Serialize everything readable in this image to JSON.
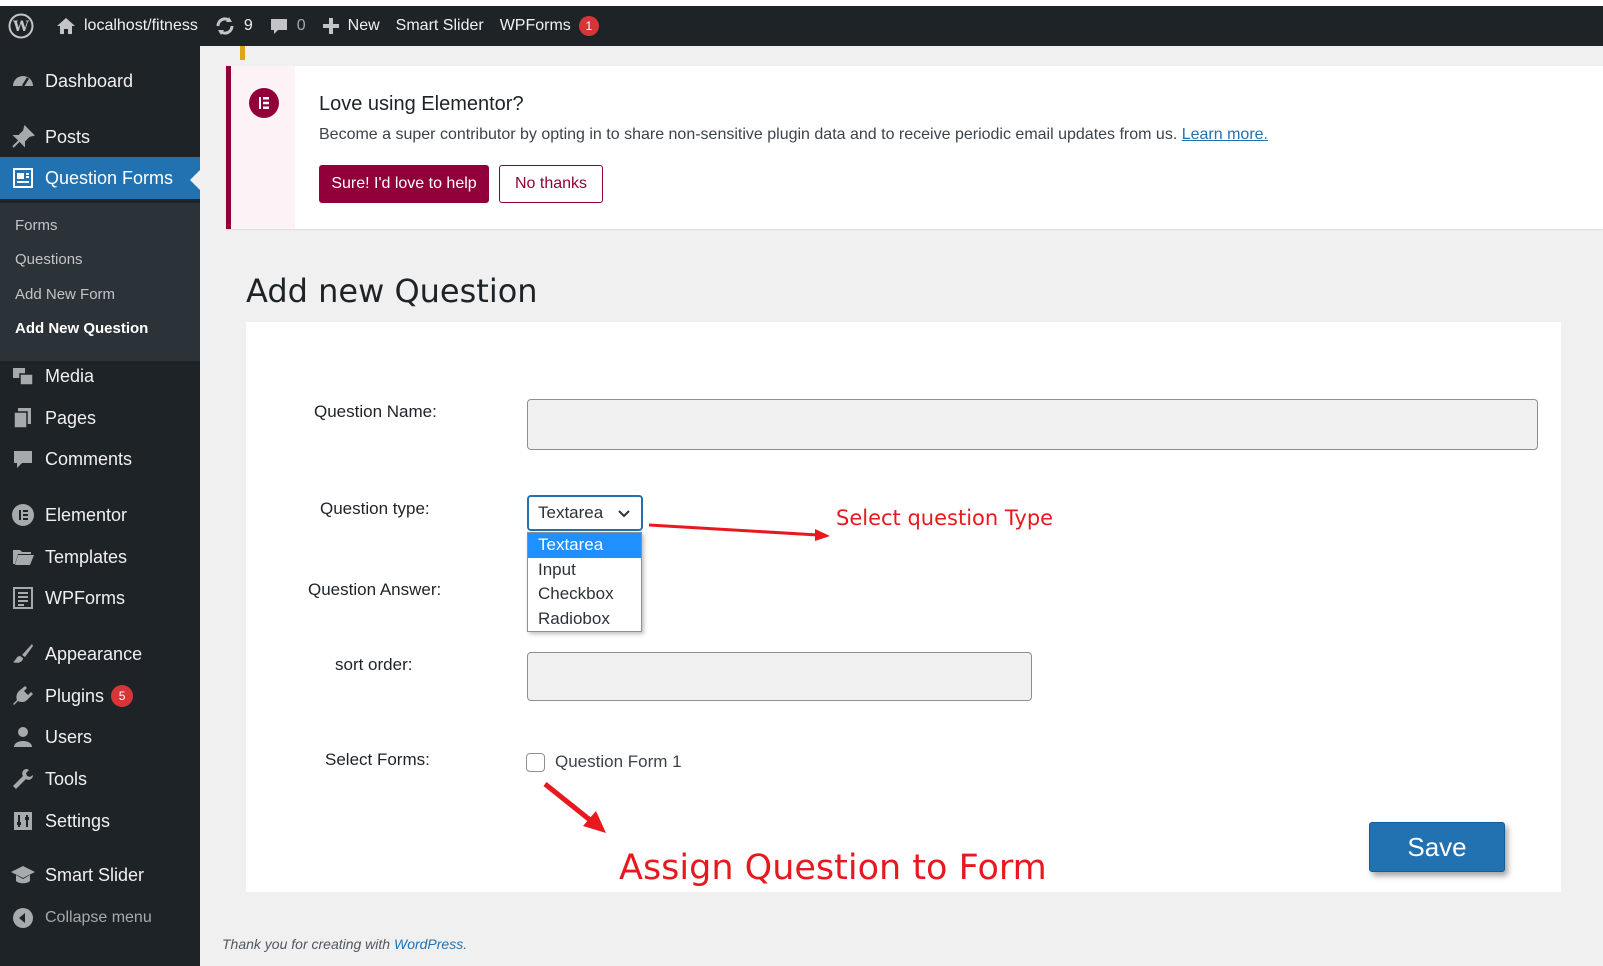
{
  "adminbar": {
    "site": "localhost/fitness",
    "updates_count": "9",
    "comments_count": "0",
    "new_label": "New",
    "smart_slider": "Smart Slider",
    "wpforms": "WPForms",
    "wpforms_badge": "1"
  },
  "sidebar": {
    "items": [
      {
        "label": "Dashboard",
        "icon": "dashboard-icon"
      },
      {
        "label": "Posts",
        "icon": "pin-icon"
      },
      {
        "label": "Question Forms",
        "icon": "form-icon"
      },
      {
        "label": "Media",
        "icon": "media-icon"
      },
      {
        "label": "Pages",
        "icon": "pages-icon"
      },
      {
        "label": "Comments",
        "icon": "comment-icon"
      },
      {
        "label": "Elementor",
        "icon": "elementor-icon"
      },
      {
        "label": "Templates",
        "icon": "folder-icon"
      },
      {
        "label": "WPForms",
        "icon": "wpforms-icon"
      },
      {
        "label": "Appearance",
        "icon": "brush-icon"
      },
      {
        "label": "Plugins",
        "icon": "plug-icon",
        "badge": "5"
      },
      {
        "label": "Users",
        "icon": "user-icon"
      },
      {
        "label": "Tools",
        "icon": "wrench-icon"
      },
      {
        "label": "Settings",
        "icon": "settings-icon"
      },
      {
        "label": "Smart Slider",
        "icon": "graduation-cap-icon"
      },
      {
        "label": "Collapse menu",
        "icon": "collapse-icon"
      }
    ],
    "submenu": [
      "Forms",
      "Questions",
      "Add New Form",
      "Add New Question"
    ]
  },
  "notice": {
    "title": "Love using Elementor?",
    "text": "Become a super contributor by opting in to share non-sensitive plugin data and to receive periodic email updates from us.",
    "link": "Learn more.",
    "primary_button": "Sure! I'd love to help",
    "secondary_button": "No thanks"
  },
  "page": {
    "title": "Add new Question"
  },
  "form": {
    "question_name_label": "Question Name:",
    "question_type_label": "Question type:",
    "question_type_value": "Textarea",
    "question_type_options": [
      "Textarea",
      "Input",
      "Checkbox",
      "Radiobox"
    ],
    "question_answer_label": "Question Answer:",
    "sort_order_label": "sort order:",
    "select_forms_label": "Select Forms:",
    "form_option": "Question Form 1",
    "save_label": "Save"
  },
  "annotations": {
    "select_type": "Select question Type",
    "assign": "Assign Question to Form"
  },
  "footer": {
    "text": "Thank you for creating with",
    "link": "WordPress."
  },
  "colors": {
    "admin_dark": "#1d2327",
    "accent_blue": "#2271b1",
    "elementor_brand": "#92003b",
    "annotation_red": "#e8191e",
    "badge_red": "#d63638"
  }
}
